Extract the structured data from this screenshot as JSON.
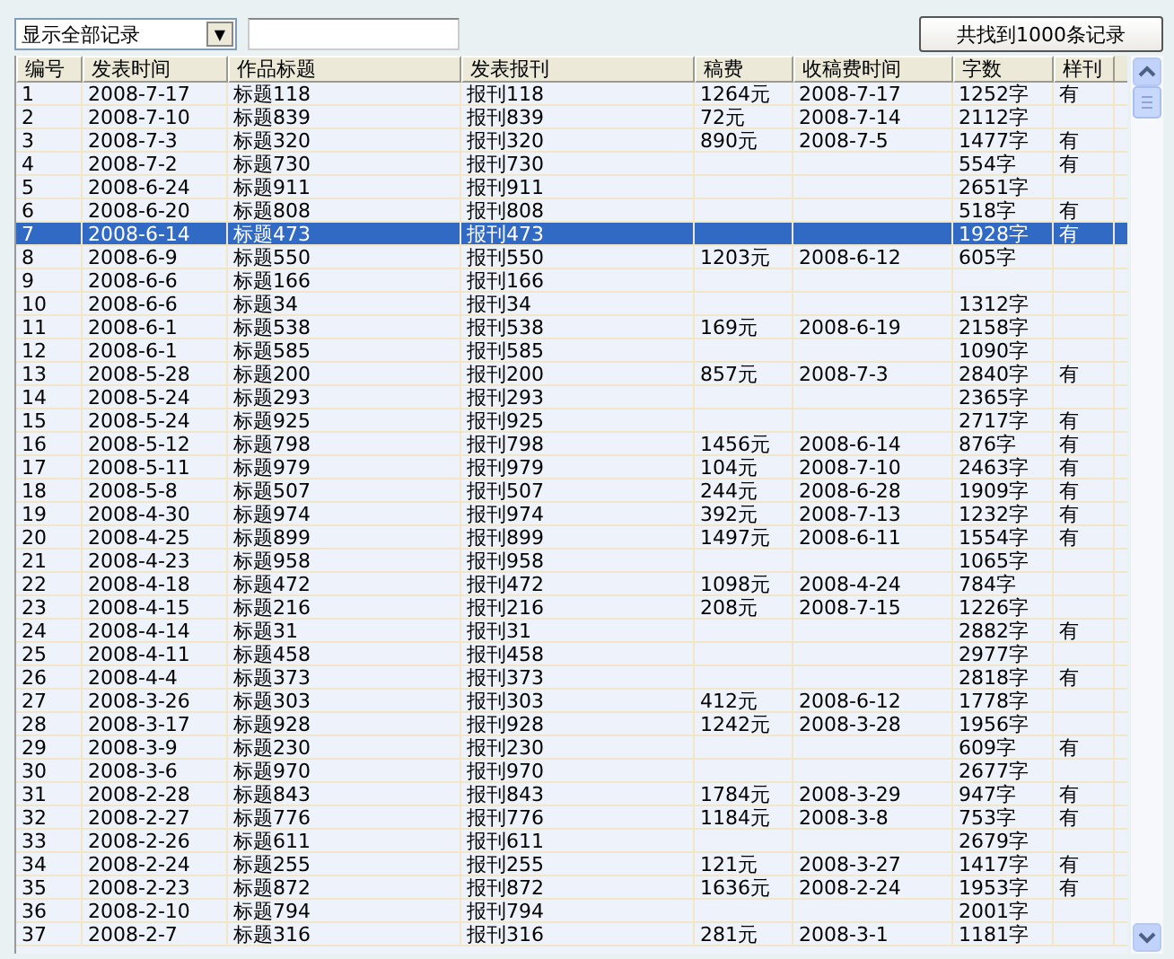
{
  "filter": {
    "value": "显示全部记录",
    "arrow": "▼"
  },
  "result_button": "共找到1000条记录",
  "table": {
    "columns": [
      "编号",
      "发表时间",
      "作品标题",
      "发表报刊",
      "稿费",
      "收稿费时间",
      "字数",
      "样刊"
    ],
    "rows": [
      {
        "no": "1",
        "date": "2008-7-17",
        "title": "标题118",
        "paper": "报刊118",
        "fee": "1264元",
        "fee_date": "2008-7-17",
        "words": "1252字",
        "sample": "有",
        "selected": false
      },
      {
        "no": "2",
        "date": "2008-7-10",
        "title": "标题839",
        "paper": "报刊839",
        "fee": "72元",
        "fee_date": "2008-7-14",
        "words": "2112字",
        "selected": false
      },
      {
        "no": "3",
        "date": "2008-7-3",
        "title": "标题320",
        "paper": "报刊320",
        "fee": "890元",
        "fee_date": "2008-7-5",
        "words": "1477字",
        "sample": "有",
        "selected": false
      },
      {
        "no": "4",
        "date": "2008-7-2",
        "title": "标题730",
        "paper": "报刊730",
        "words": "554字",
        "sample": "有",
        "selected": false
      },
      {
        "no": "5",
        "date": "2008-6-24",
        "title": "标题911",
        "paper": "报刊911",
        "words": "2651字",
        "selected": false
      },
      {
        "no": "6",
        "date": "2008-6-20",
        "title": "标题808",
        "paper": "报刊808",
        "words": "518字",
        "sample": "有",
        "selected": false
      },
      {
        "no": "7",
        "date": "2008-6-14",
        "title": "标题473",
        "paper": "报刊473",
        "words": "1928字",
        "sample": "有",
        "selected": true
      },
      {
        "no": "8",
        "date": "2008-6-9",
        "title": "标题550",
        "paper": "报刊550",
        "fee": "1203元",
        "fee_date": "2008-6-12",
        "words": "605字",
        "selected": false
      },
      {
        "no": "9",
        "date": "2008-6-6",
        "title": "标题166",
        "paper": "报刊166",
        "selected": false
      },
      {
        "no": "10",
        "date": "2008-6-6",
        "title": "标题34",
        "paper": "报刊34",
        "words": "1312字",
        "selected": false
      },
      {
        "no": "11",
        "date": "2008-6-1",
        "title": "标题538",
        "paper": "报刊538",
        "fee": "169元",
        "fee_date": "2008-6-19",
        "words": "2158字",
        "selected": false
      },
      {
        "no": "12",
        "date": "2008-6-1",
        "title": "标题585",
        "paper": "报刊585",
        "words": "1090字",
        "selected": false
      },
      {
        "no": "13",
        "date": "2008-5-28",
        "title": "标题200",
        "paper": "报刊200",
        "fee": "857元",
        "fee_date": "2008-7-3",
        "words": "2840字",
        "sample": "有",
        "selected": false
      },
      {
        "no": "14",
        "date": "2008-5-24",
        "title": "标题293",
        "paper": "报刊293",
        "words": "2365字",
        "selected": false
      },
      {
        "no": "15",
        "date": "2008-5-24",
        "title": "标题925",
        "paper": "报刊925",
        "words": "2717字",
        "sample": "有",
        "selected": false
      },
      {
        "no": "16",
        "date": "2008-5-12",
        "title": "标题798",
        "paper": "报刊798",
        "fee": "1456元",
        "fee_date": "2008-6-14",
        "words": "876字",
        "sample": "有",
        "selected": false
      },
      {
        "no": "17",
        "date": "2008-5-11",
        "title": "标题979",
        "paper": "报刊979",
        "fee": "104元",
        "fee_date": "2008-7-10",
        "words": "2463字",
        "sample": "有",
        "selected": false
      },
      {
        "no": "18",
        "date": "2008-5-8",
        "title": "标题507",
        "paper": "报刊507",
        "fee": "244元",
        "fee_date": "2008-6-28",
        "words": "1909字",
        "sample": "有",
        "selected": false
      },
      {
        "no": "19",
        "date": "2008-4-30",
        "title": "标题974",
        "paper": "报刊974",
        "fee": "392元",
        "fee_date": "2008-7-13",
        "words": "1232字",
        "sample": "有",
        "selected": false
      },
      {
        "no": "20",
        "date": "2008-4-25",
        "title": "标题899",
        "paper": "报刊899",
        "fee": "1497元",
        "fee_date": "2008-6-11",
        "words": "1554字",
        "sample": "有",
        "selected": false
      },
      {
        "no": "21",
        "date": "2008-4-23",
        "title": "标题958",
        "paper": "报刊958",
        "words": "1065字",
        "selected": false
      },
      {
        "no": "22",
        "date": "2008-4-18",
        "title": "标题472",
        "paper": "报刊472",
        "fee": "1098元",
        "fee_date": "2008-4-24",
        "words": "784字",
        "selected": false
      },
      {
        "no": "23",
        "date": "2008-4-15",
        "title": "标题216",
        "paper": "报刊216",
        "fee": "208元",
        "fee_date": "2008-7-15",
        "words": "1226字",
        "selected": false
      },
      {
        "no": "24",
        "date": "2008-4-14",
        "title": "标题31",
        "paper": "报刊31",
        "words": "2882字",
        "sample": "有",
        "selected": false
      },
      {
        "no": "25",
        "date": "2008-4-11",
        "title": "标题458",
        "paper": "报刊458",
        "words": "2977字",
        "selected": false
      },
      {
        "no": "26",
        "date": "2008-4-4",
        "title": "标题373",
        "paper": "报刊373",
        "words": "2818字",
        "sample": "有",
        "selected": false
      },
      {
        "no": "27",
        "date": "2008-3-26",
        "title": "标题303",
        "paper": "报刊303",
        "fee": "412元",
        "fee_date": "2008-6-12",
        "words": "1778字",
        "selected": false
      },
      {
        "no": "28",
        "date": "2008-3-17",
        "title": "标题928",
        "paper": "报刊928",
        "fee": "1242元",
        "fee_date": "2008-3-28",
        "words": "1956字",
        "selected": false
      },
      {
        "no": "29",
        "date": "2008-3-9",
        "title": "标题230",
        "paper": "报刊230",
        "words": "609字",
        "sample": "有",
        "selected": false
      },
      {
        "no": "30",
        "date": "2008-3-6",
        "title": "标题970",
        "paper": "报刊970",
        "words": "2677字",
        "selected": false
      },
      {
        "no": "31",
        "date": "2008-2-28",
        "title": "标题843",
        "paper": "报刊843",
        "fee": "1784元",
        "fee_date": "2008-3-29",
        "words": "947字",
        "sample": "有",
        "selected": false
      },
      {
        "no": "32",
        "date": "2008-2-27",
        "title": "标题776",
        "paper": "报刊776",
        "fee": "1184元",
        "fee_date": "2008-3-8",
        "words": "753字",
        "sample": "有",
        "selected": false
      },
      {
        "no": "33",
        "date": "2008-2-26",
        "title": "标题611",
        "paper": "报刊611",
        "words": "2679字",
        "selected": false
      },
      {
        "no": "34",
        "date": "2008-2-24",
        "title": "标题255",
        "paper": "报刊255",
        "fee": "121元",
        "fee_date": "2008-3-27",
        "words": "1417字",
        "sample": "有",
        "selected": false
      },
      {
        "no": "35",
        "date": "2008-2-23",
        "title": "标题872",
        "paper": "报刊872",
        "fee": "1636元",
        "fee_date": "2008-2-24",
        "words": "1953字",
        "sample": "有",
        "selected": false
      },
      {
        "no": "36",
        "date": "2008-2-10",
        "title": "标题794",
        "paper": "报刊794",
        "words": "2001字",
        "selected": false
      },
      {
        "no": "37",
        "date": "2008-2-7",
        "title": "标题316",
        "paper": "报刊316",
        "fee": "281元",
        "fee_date": "2008-3-1",
        "words": "1181字",
        "selected": false
      }
    ]
  }
}
